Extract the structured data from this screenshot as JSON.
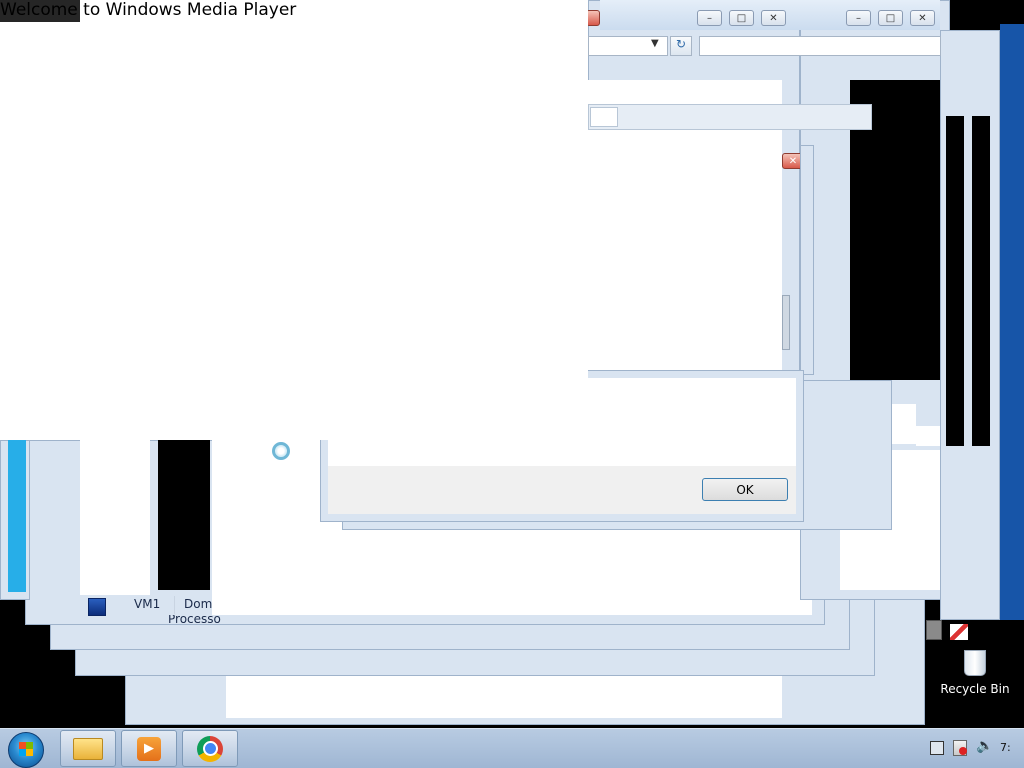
{
  "wmp": {
    "title": "Welcome to Windows Media Player"
  },
  "dialog": {
    "ok_label": "OK"
  },
  "explorer_row": {
    "name": "VM1",
    "type_partial": "Dom",
    "sub_partial": "Processo"
  },
  "desktop": {
    "recycle_bin_label": "Recycle Bin"
  },
  "taskbar": {
    "pinned": [
      "windows-explorer",
      "windows-media-player",
      "google-chrome"
    ],
    "clock_partial": "7:"
  },
  "icons": {
    "start": "windows-start-orb",
    "busy": "busy-spinner",
    "tray": [
      "network-icon",
      "action-center-flag-icon",
      "volume-icon"
    ]
  }
}
